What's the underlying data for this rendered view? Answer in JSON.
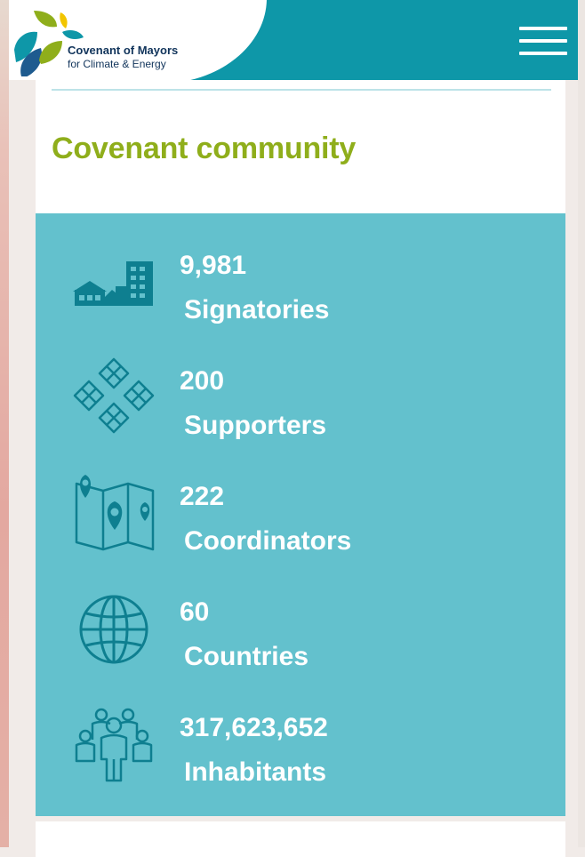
{
  "header": {
    "logo_title": "Covenant of Mayors",
    "logo_subtitle": "for Climate & Energy",
    "menu_icon": "hamburger-menu-icon"
  },
  "section": {
    "title": "Covenant community"
  },
  "stats": [
    {
      "value": "9,981",
      "label": "Signatories",
      "icon": "buildings-icon"
    },
    {
      "value": "200",
      "label": "Supporters",
      "icon": "handshake-circle-icon"
    },
    {
      "value": "222",
      "label": "Coordinators",
      "icon": "map-pins-icon"
    },
    {
      "value": "60",
      "label": "Countries",
      "icon": "globe-icon"
    },
    {
      "value": "317,623,652",
      "label": "Inhabitants",
      "icon": "people-group-icon"
    }
  ],
  "colors": {
    "header_teal": "#0e97a8",
    "title_green": "#8fae1b",
    "stats_bg": "#63c1cd",
    "icon_stroke": "#0e7f90",
    "logo_navy": "#11345b"
  }
}
